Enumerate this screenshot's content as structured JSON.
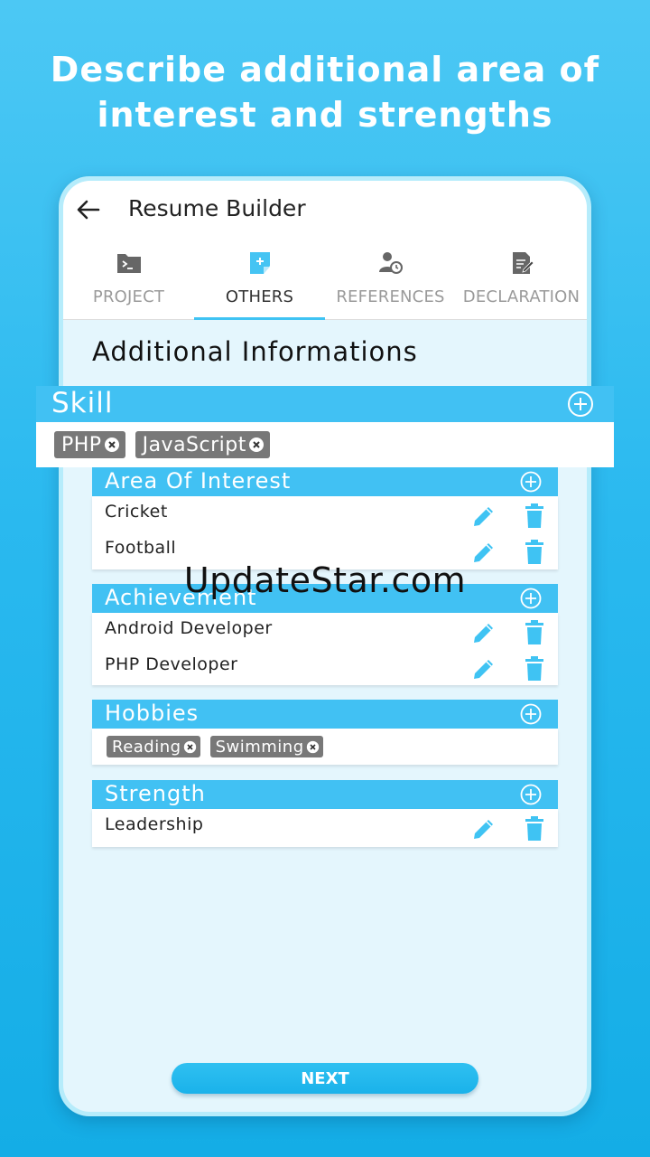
{
  "headline": {
    "line1": "Describe additional area of",
    "line2": "interest and strengths"
  },
  "appbar": {
    "title": "Resume Builder"
  },
  "tabs": [
    {
      "label": "PROJECT",
      "icon": "folder-icon"
    },
    {
      "label": "OTHERS",
      "icon": "note-add-icon",
      "active": true
    },
    {
      "label": "REFERENCES",
      "icon": "person-clock-icon"
    },
    {
      "label": "DECLARATION",
      "icon": "document-edit-icon"
    }
  ],
  "section_heading": "Additional Informations",
  "skill": {
    "title": "Skill",
    "chips": [
      "PHP",
      "JavaScript"
    ]
  },
  "area_of_interest": {
    "title": "Area Of Interest",
    "items": [
      "Cricket",
      "Football"
    ]
  },
  "achievement": {
    "title": "Achievement",
    "items": [
      "Android Developer",
      "PHP Developer"
    ]
  },
  "hobbies": {
    "title": "Hobbies",
    "chips": [
      "Reading",
      "Swimming"
    ]
  },
  "strength": {
    "title": "Strength",
    "items": [
      "Leadership"
    ]
  },
  "next_label": "NEXT",
  "watermark": "UpdateStar.com",
  "colors": {
    "accent": "#41c1f3",
    "chip": "#787878",
    "background": "#2ab9ef"
  }
}
